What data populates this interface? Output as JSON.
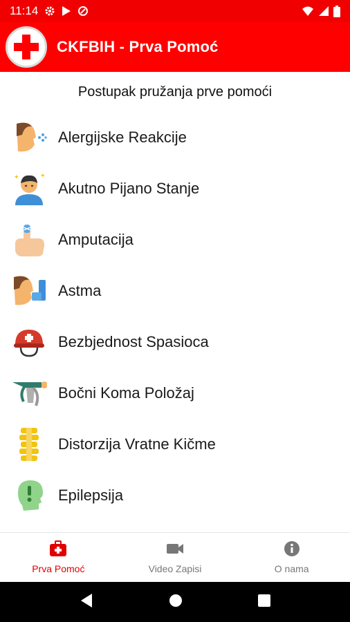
{
  "status_bar": {
    "time": "11:14",
    "left_icons": [
      "gear-icon",
      "play-store-icon",
      "data-saver-icon"
    ],
    "right_icons": [
      "wifi-icon",
      "signal-icon",
      "battery-icon"
    ]
  },
  "app_bar": {
    "logo": "red-cross-logo",
    "title": "CKFBIH - Prva Pomoć",
    "color": "#ff0000"
  },
  "main": {
    "section_title": "Postupak pružanja prve pomoći",
    "items": [
      {
        "label": "Alergijske Reakcije",
        "icon": "sneezing-face-icon"
      },
      {
        "label": "Akutno Pijano Stanje",
        "icon": "dizzy-person-icon"
      },
      {
        "label": "Amputacija",
        "icon": "bandaged-finger-icon"
      },
      {
        "label": "Astma",
        "icon": "inhaler-icon"
      },
      {
        "label": "Bezbjednost Spasioca",
        "icon": "rescue-helmet-icon"
      },
      {
        "label": "Bočni Koma Položaj",
        "icon": "recovery-position-icon"
      },
      {
        "label": "Distorzija Vratne Kičme",
        "icon": "spine-icon"
      },
      {
        "label": "Epilepsija",
        "icon": "head-alert-icon"
      }
    ]
  },
  "bottom_nav": {
    "active_color": "#e00000",
    "tabs": [
      {
        "label": "Prva Pomoć",
        "icon": "first-aid-kit-icon",
        "active": true
      },
      {
        "label": "Video Zapisi",
        "icon": "video-camera-icon",
        "active": false
      },
      {
        "label": "O nama",
        "icon": "info-icon",
        "active": false
      }
    ]
  },
  "system_nav": {
    "buttons": [
      "back-icon",
      "home-icon",
      "recents-icon"
    ]
  }
}
